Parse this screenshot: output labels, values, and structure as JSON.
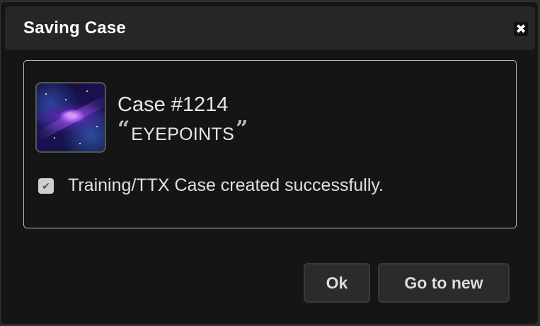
{
  "dialog": {
    "title": "Saving Case",
    "close_icon": "close-icon"
  },
  "case": {
    "number": "Case #1214",
    "name": "EYEPOINTS",
    "open_quote": "“",
    "close_quote": "”",
    "image_icon": "galaxy-thumbnail"
  },
  "status": {
    "checked": true,
    "message": "Training/TTX Case created successfully."
  },
  "buttons": {
    "ok_label": "Ok",
    "go_to_new_label": "Go to new"
  }
}
